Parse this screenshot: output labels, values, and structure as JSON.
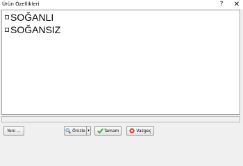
{
  "window": {
    "title": "Ürün Özellikleri",
    "help_label": "?",
    "close_label": "✕"
  },
  "items": [
    {
      "label": "SOĞANLI",
      "checked": false
    },
    {
      "label": "SOĞANSIZ",
      "checked": false
    }
  ],
  "status": {
    "text": ""
  },
  "buttons": {
    "new_label": "Yeni ...",
    "preview_label": "Önizle",
    "preview_dropdown": "▾",
    "ok_label": "Tamam",
    "cancel_label": "Vazgeç"
  },
  "colors": {
    "ok_icon": "#3fa63f",
    "cancel_icon": "#d93a2b",
    "preview_icon": "#4a7fc1"
  }
}
